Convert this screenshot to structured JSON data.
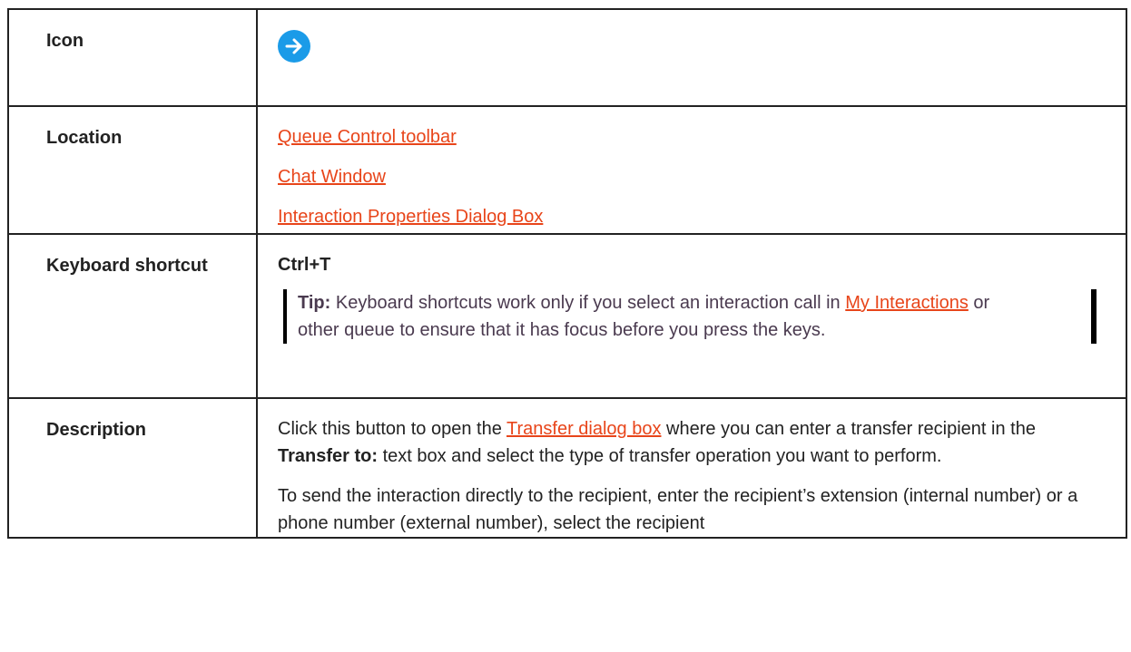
{
  "rows": {
    "icon": {
      "label": "Icon",
      "icon_name": "arrow-right-circle-icon",
      "icon_color": "#1b9be8"
    },
    "location": {
      "label": "Location",
      "links": [
        "Queue Control toolbar",
        "Chat Window",
        "Interaction Properties Dialog Box"
      ]
    },
    "keyboard": {
      "label": "Keyboard shortcut",
      "shortcut": "Ctrl+T",
      "tip": {
        "prefix": "Tip:",
        "text1": " Keyboard shortcuts work only if you select an interaction call in ",
        "link": "My Interactions",
        "text2": " or other queue to ensure that it has focus before you press the keys."
      }
    },
    "description": {
      "label": "Description",
      "p1": {
        "text1": "Click this button to open the ",
        "link": "Transfer dialog box",
        "text2": " where you can enter a transfer recipient in the ",
        "bold": "Transfer to:",
        "text3": " text box and select the type of transfer operation you want to perform."
      },
      "p2": "To send the interaction directly to the recipient, enter the recipient’s extension (internal number) or a phone number (external number), select the recipient"
    }
  },
  "colors": {
    "link": "#e8451a",
    "accent": "#1b9be8"
  }
}
